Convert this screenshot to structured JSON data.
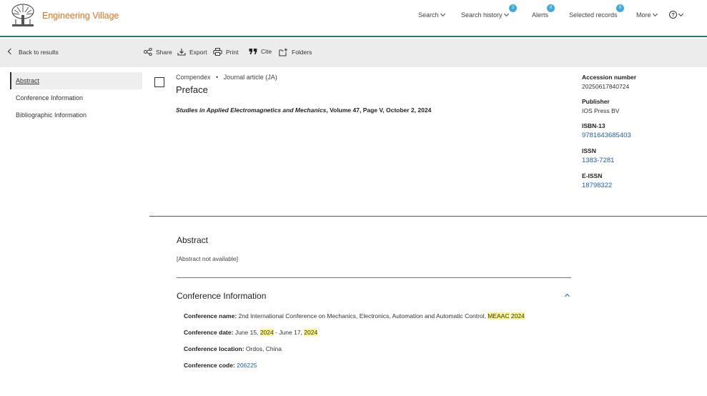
{
  "header": {
    "brand": "Engineering Village",
    "nav": {
      "search": "Search",
      "search_history": "Search history",
      "search_history_count": "2",
      "alerts": "Alerts",
      "alerts_count": "0",
      "selected_records": "Selected records",
      "selected_records_count": "0",
      "more": "More",
      "help": "?"
    }
  },
  "toolbar": {
    "back": "Back to results",
    "share": "Share",
    "export": "Export",
    "print": "Print",
    "cite": "Cite",
    "folders": "Folders"
  },
  "sidenav": {
    "items": [
      "Abstract",
      "Conference Information",
      "Bibliographic Information"
    ]
  },
  "record": {
    "database": "Compendex",
    "separator": "•",
    "doc_type": "Journal article (JA)",
    "title": "Preface",
    "citation": {
      "journal": "Studies in Applied Electromagnetics and Mechanics",
      "rest": ", Volume 47, Page V, October 2, 2024"
    }
  },
  "details": {
    "accession_label": "Accession number",
    "accession_value": "20250617840724",
    "publisher_label": "Publisher",
    "publisher_value": "IOS Press BV",
    "isbn_label": "ISBN-13",
    "isbn_value": "9781643685403",
    "issn_label": "ISSN",
    "issn_value": "1383-7281",
    "eissn_label": "E-ISSN",
    "eissn_value": "18798322"
  },
  "abstract": {
    "title": "Abstract",
    "text": "[Abstract not available]"
  },
  "conference": {
    "title": "Conference Information",
    "name_label": "Conference name:",
    "name_value": "2nd International Conference on Mechanics, Electronics, Automation and Automatic Control,",
    "name_hl1": "MEAAC",
    "name_hl2": "2024",
    "date_label": "Conference date:",
    "date_part1": "June 15,",
    "date_hl1": "2024",
    "date_part2": "- June 17,",
    "date_hl2": "2024",
    "location_label": "Conference location:",
    "location_value": "Ordos, China",
    "code_label": "Conference code:",
    "code_value": "206225"
  },
  "colors": {
    "brand": "#e9711c",
    "accent_line": "#2a7a5c",
    "link": "#1f60b5",
    "badge": "#3fa9e0",
    "highlight": "#fbf48a"
  }
}
